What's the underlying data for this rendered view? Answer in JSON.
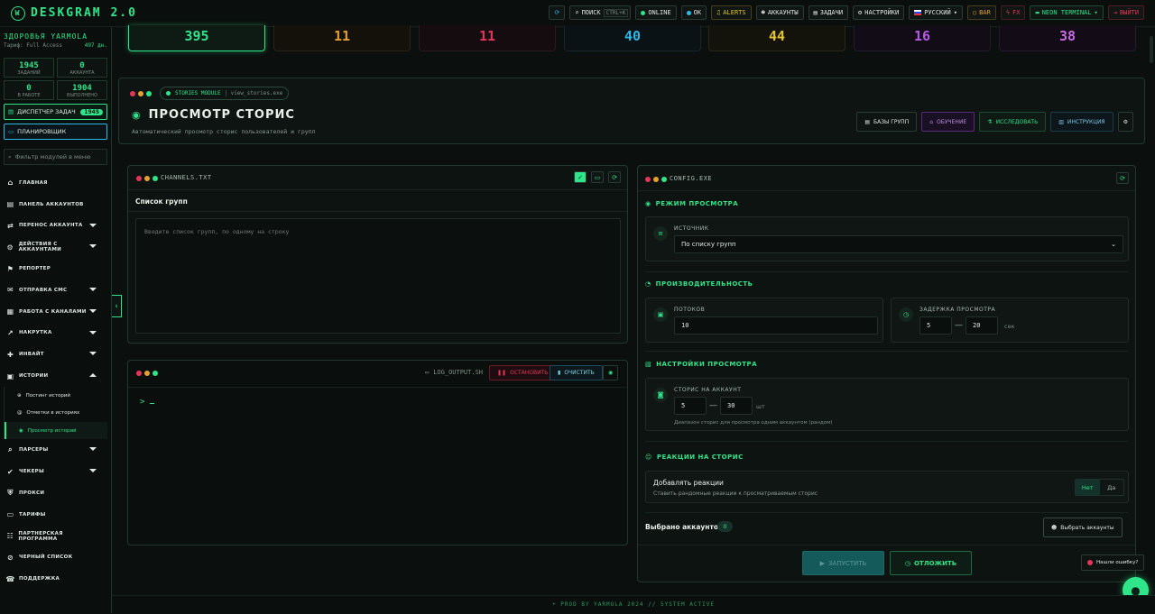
{
  "app": {
    "name": "DESKGRAM 2.0",
    "logo_glyph": "W"
  },
  "topbar": {
    "refresh_icon": "refresh-icon",
    "search_label": "ПОИСК",
    "search_key": "CTRL+K",
    "online": "ONLINE",
    "ok": "OK",
    "alerts": "ALERTS",
    "accounts": "АККАУНТЫ",
    "tasks": "ЗАДАЧИ",
    "settings": "НАСТРОЙКИ",
    "language": "РУССКИЙ",
    "bar": "BAR",
    "fx": "FX",
    "theme": "NEON TERMINAL",
    "logout": "ВЫЙТИ"
  },
  "user": {
    "name": "ЗДОРОВЬЯ YARMOLA",
    "tariff": "Тариф: Full Access",
    "days": "497 дн."
  },
  "stats_small": [
    {
      "value": "1945",
      "label": "ЗАДАНИЙ"
    },
    {
      "value": "0",
      "label": "АККАУНТА"
    },
    {
      "value": "0",
      "label": "В РАБОТЕ"
    },
    {
      "value": "1904",
      "label": "ВЫПОЛНЕНО"
    }
  ],
  "sidebar": {
    "dispatcher": "ДИСПЕТЧЕР ЗАДАЧ",
    "dispatcher_badge": "1945",
    "scheduler": "ПЛАНИРОВЩИК",
    "filter_placeholder": "Фильтр модулей в меню",
    "items": [
      {
        "label": "ГЛАВНАЯ",
        "icon": "⌂"
      },
      {
        "label": "ПАНЕЛЬ АККАУНТОВ",
        "icon": "▤"
      },
      {
        "label": "ПЕРЕНОС АККАУНТА",
        "icon": "⇄"
      },
      {
        "label": "ДЕЙСТВИЯ С АККАУНТАМИ",
        "icon": "⚙"
      },
      {
        "label": "РЕПОРТЕР",
        "icon": "⚑"
      },
      {
        "label": "ОТПРАВКА СМС",
        "icon": "✉"
      },
      {
        "label": "РАБОТА С КАНАЛАМИ",
        "icon": "▦"
      },
      {
        "label": "НАКРУТКА",
        "icon": "↗"
      },
      {
        "label": "ИНВАЙТ",
        "icon": "✚"
      },
      {
        "label": "ИСТОРИИ",
        "icon": "▣"
      }
    ],
    "sub_items": [
      {
        "label": "Постинг историй",
        "icon": "⊕"
      },
      {
        "label": "Отметки в историях",
        "icon": "@"
      },
      {
        "label": "Просмотр историй",
        "icon": "◉"
      }
    ],
    "items_after": [
      {
        "label": "ПАРСЕРЫ",
        "icon": "⌕"
      },
      {
        "label": "ЧЕКЕРЫ",
        "icon": "✔"
      },
      {
        "label": "ПРОКСИ",
        "icon": "⛨"
      },
      {
        "label": "ТАРИФЫ",
        "icon": "▭"
      },
      {
        "label": "ПАРТНЕРСКАЯ ПРОГРАММА",
        "icon": "☷"
      },
      {
        "label": "ЧЕРНЫЙ СПИСОК",
        "icon": "⊘"
      },
      {
        "label": "ПОДДЕРЖКА",
        "icon": "☎"
      }
    ]
  },
  "top_stats": [
    {
      "value": "395",
      "color": "#2fe58a"
    },
    {
      "value": "11",
      "color": "#e5a02f"
    },
    {
      "value": "11",
      "color": "#e5365a"
    },
    {
      "value": "40",
      "color": "#2fb8e5"
    },
    {
      "value": "44",
      "color": "#e5c52f"
    },
    {
      "value": "16",
      "color": "#b85ae5"
    },
    {
      "value": "38",
      "color": "#c86ae5"
    }
  ],
  "header": {
    "module": "STORIES MODULE",
    "file": "view_stories.exe",
    "title": "ПРОСМОТР СТОРИС",
    "subtitle": "Автоматический просмотр сторис пользователей и групп",
    "btn_bases": "БАЗЫ ГРУПП",
    "btn_learn": "ОБУЧЕНИЕ",
    "btn_research": "ИССЛЕДОВАТЬ",
    "btn_guide": "ИНСТРУКЦИЯ"
  },
  "channels": {
    "file": "CHANNELS.TXT",
    "title": "Список групп",
    "placeholder": "Введите список групп, по одному на строку"
  },
  "log": {
    "file": "LOG_OUTPUT.SH",
    "stop": "ОСТАНОВИТЬ",
    "clear": "ОЧИСТИТЬ",
    "prompt": ">"
  },
  "config": {
    "file": "CONFIG.EXE",
    "mode_title": "РЕЖИМ ПРОСМОТРА",
    "source_label": "ИСТОЧНИК",
    "source_value": "По списку групп",
    "perf_title": "ПРОИЗВОДИТЕЛЬНОСТЬ",
    "threads_label": "ПОТОКОВ",
    "threads_value": "10",
    "delay_label": "ЗАДЕРЖКА ПРОСМОТРА",
    "delay_min": "5",
    "delay_max": "20",
    "delay_unit": "сек",
    "view_title": "НАСТРОЙКИ ПРОСМОТРА",
    "stories_label": "СТОРИС НА АККАУНТ",
    "stories_min": "5",
    "stories_max": "30",
    "stories_unit": "шт",
    "stories_hint": "Диапазон сторис для просмотра одним аккаунтом (рандом)",
    "reactions_title": "РЕАКЦИИ НА СТОРИС",
    "reactions_label": "Добавлять реакции",
    "reactions_hint": "Ставить рандомные реакции к просматриваемым сторис",
    "opt_no": "Нет",
    "opt_yes": "Да",
    "accounts_label": "Выбрано аккаунтов:",
    "accounts_count": "0",
    "choose_btn": "Выбрать аккаунты",
    "start": "ЗАПУСТИТЬ",
    "postpone": "ОТЛОЖИТЬ",
    "dash": "—"
  },
  "bug_report": "Нашли ошибку?",
  "footer": "• PROD BY YARMOLA 2024  // SYSTEM ACTIVE"
}
